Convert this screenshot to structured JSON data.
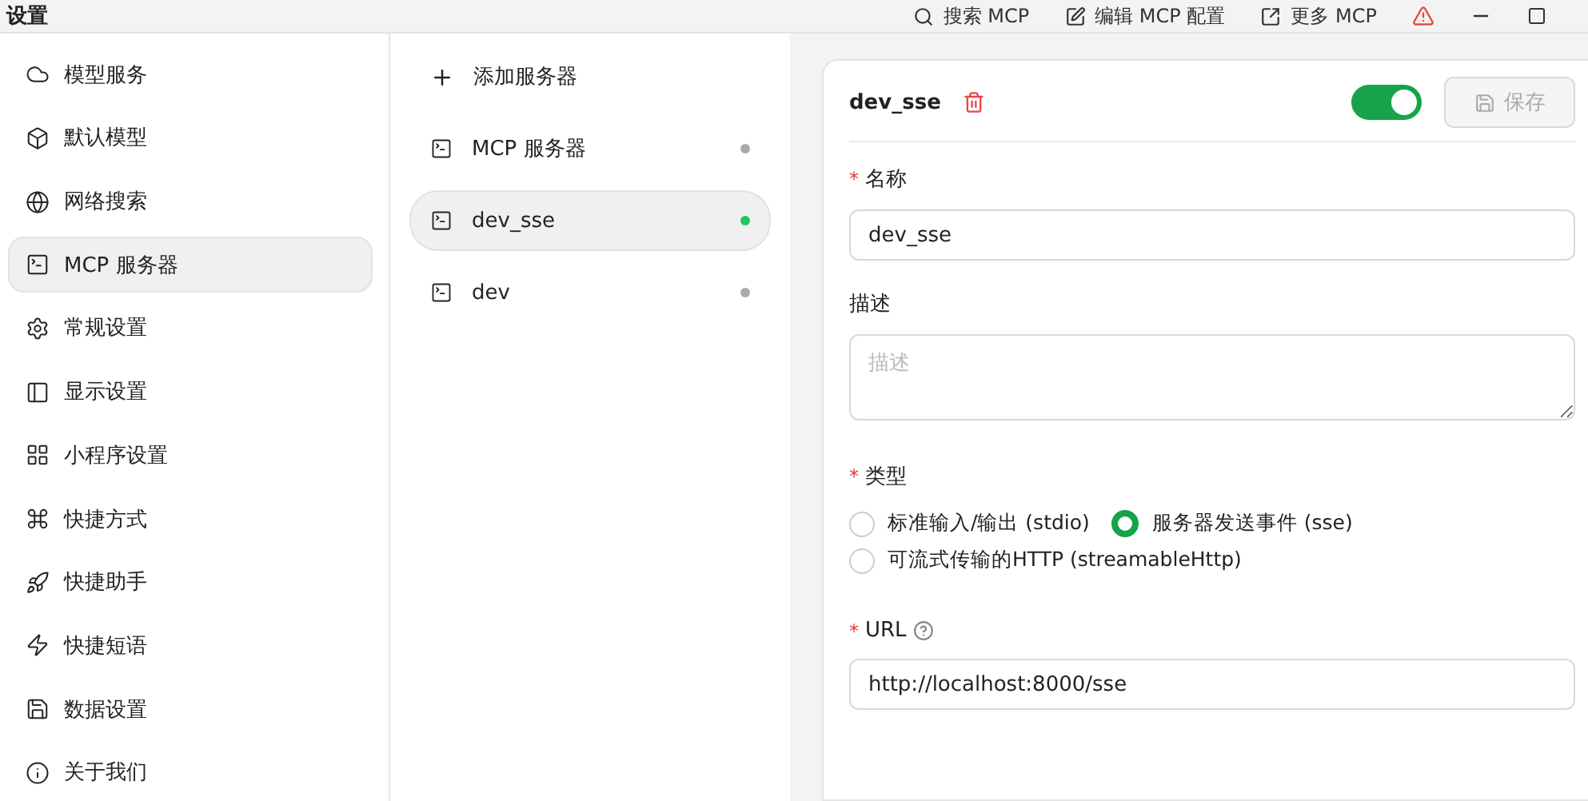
{
  "window": {
    "title": "设置"
  },
  "toolbar": [
    {
      "kind": "search",
      "label": "搜索 MCP"
    },
    {
      "kind": "edit",
      "label": "编辑 MCP 配置"
    },
    {
      "kind": "more",
      "label": "更多 MCP"
    },
    {
      "kind": "warning"
    },
    {
      "kind": "minimize"
    },
    {
      "kind": "maximize"
    }
  ],
  "sidebar": {
    "items": [
      {
        "kind": "cloud",
        "label": "模型服务",
        "selected": false
      },
      {
        "kind": "cube",
        "label": "默认模型",
        "selected": false
      },
      {
        "kind": "globe",
        "label": "网络搜索",
        "selected": false
      },
      {
        "kind": "terminal",
        "label": "MCP 服务器",
        "selected": true
      },
      {
        "kind": "gear",
        "label": "常规设置",
        "selected": false
      },
      {
        "kind": "layout",
        "label": "显示设置",
        "selected": false
      },
      {
        "kind": "grid",
        "label": "小程序设置",
        "selected": false
      },
      {
        "kind": "command",
        "label": "快捷方式",
        "selected": false
      },
      {
        "kind": "rocket",
        "label": "快捷助手",
        "selected": false
      },
      {
        "kind": "zap",
        "label": "快捷短语",
        "selected": false
      },
      {
        "kind": "save",
        "label": "数据设置",
        "selected": false
      },
      {
        "kind": "info",
        "label": "关于我们",
        "selected": false
      }
    ]
  },
  "servers": {
    "add_label": "添加服务器",
    "items": [
      {
        "name": "MCP 服务器",
        "active": false,
        "selected": false
      },
      {
        "name": "dev_sse",
        "active": true,
        "selected": true
      },
      {
        "name": "dev",
        "active": false,
        "selected": false
      }
    ]
  },
  "editor": {
    "title": "dev_sse",
    "enabled": true,
    "save_label": "保存",
    "save_disabled": true,
    "name_mark": "*",
    "name_label": "名称",
    "name_value": "dev_sse",
    "description_label": "描述",
    "description_placeholder": "描述",
    "type_mark": "*",
    "type_label": "类型",
    "types": [
      {
        "label": "标准输入/输出 (stdio)",
        "selected": false
      },
      {
        "label": "服务器发送事件 (sse)",
        "selected": true
      },
      {
        "label": "可流式传输的HTTP (streamableHttp)",
        "selected": false
      }
    ],
    "url_mark": "*",
    "url_label": "URL",
    "url_value": "http://localhost:8000/sse"
  }
}
